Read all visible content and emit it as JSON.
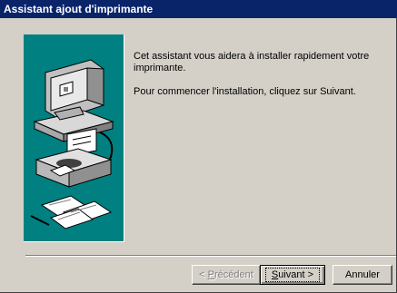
{
  "window": {
    "title": "Assistant ajout d'imprimante"
  },
  "content": {
    "paragraph1": "Cet assistant vous aidera à installer rapidement votre imprimante.",
    "paragraph2": "Pour commencer l'installation, cliquez sur Suivant."
  },
  "buttons": {
    "back": {
      "pre": "< ",
      "u": "P",
      "rest": "récédent"
    },
    "next": {
      "u": "S",
      "rest": "uivant >"
    },
    "cancel": "Annuler"
  },
  "colors": {
    "titlebar": "#0a246a",
    "panel": "#008080",
    "window": "#d4d0c8"
  },
  "icons": [
    "computer-icon",
    "printer-icon",
    "documents-icon"
  ]
}
